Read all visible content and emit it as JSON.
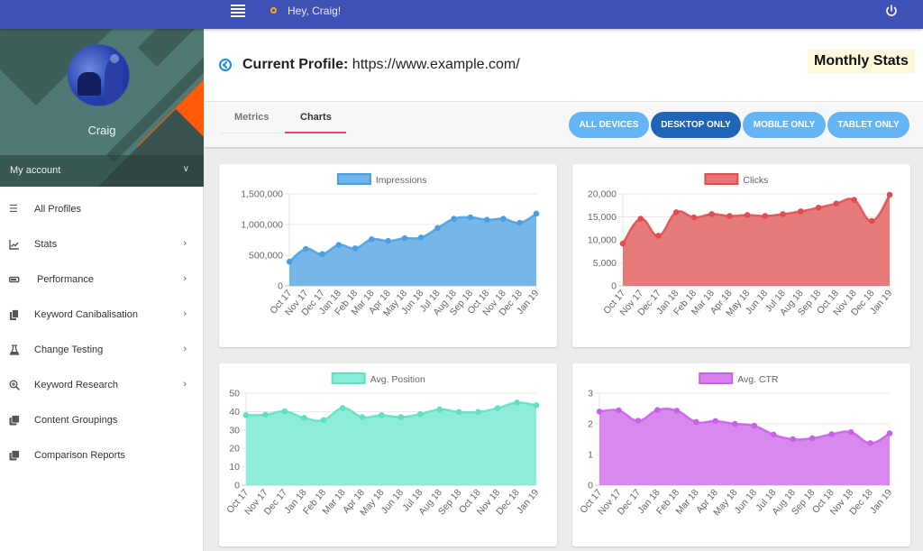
{
  "topbar": {
    "greeting": "Hey, Craig!",
    "menu_icon": "hamburger-icon",
    "status_icon": "status-dot-icon",
    "power_icon": "power-icon"
  },
  "sidebar": {
    "profile_name": "Craig",
    "account_label": "My account",
    "items": [
      {
        "label": "All Profiles",
        "icon": "list-icon",
        "glyph": "☰",
        "has_chevron": false
      },
      {
        "label": "Stats",
        "icon": "chart-line-icon",
        "glyph": "📈",
        "has_chevron": true
      },
      {
        "label": "Performance",
        "icon": "battery-icon",
        "glyph": "▭",
        "has_chevron": true
      },
      {
        "label": "Keyword Canibalisation",
        "icon": "copy-icon",
        "glyph": "❐",
        "has_chevron": true
      },
      {
        "label": "Change Testing",
        "icon": "flask-icon",
        "glyph": "⚗",
        "has_chevron": true
      },
      {
        "label": "Keyword Research",
        "icon": "zoom-in-icon",
        "glyph": "⊕",
        "has_chevron": true
      },
      {
        "label": "Content Groupings",
        "icon": "library-icon",
        "glyph": "❐",
        "has_chevron": false
      },
      {
        "label": "Comparison Reports",
        "icon": "library-icon",
        "glyph": "❐",
        "has_chevron": false
      }
    ]
  },
  "header": {
    "title_label": "Current Profile:",
    "title_value": "https://www.example.com/",
    "badge": "Monthly Stats"
  },
  "tabs": [
    {
      "label": "Metrics",
      "active": false
    },
    {
      "label": "Charts",
      "active": true
    }
  ],
  "filters": [
    {
      "label": "ALL DEVICES",
      "active": false
    },
    {
      "label": "DESKTOP ONLY",
      "active": true
    },
    {
      "label": "MOBILE ONLY",
      "active": false
    },
    {
      "label": "TABLET ONLY",
      "active": false
    }
  ],
  "chart_data": [
    {
      "type": "area",
      "title": "Impressions",
      "legend": "Impressions",
      "legend_position": "top",
      "color": "#4a9fe3",
      "fill": "#6fb3e8",
      "categories": [
        "Oct 17",
        "Nov 17",
        "Dec 17",
        "Jan 18",
        "Feb 18",
        "Mar 18",
        "Apr 18",
        "May 18",
        "Jun 18",
        "Jul 18",
        "Aug 18",
        "Sep 18",
        "Oct 18",
        "Nov 18",
        "Dec 18",
        "Jan 19"
      ],
      "values": [
        394000,
        601000,
        519000,
        667000,
        612000,
        760000,
        732000,
        777000,
        788000,
        942000,
        1094000,
        1117000,
        1078000,
        1094000,
        1029000,
        1177000
      ],
      "ylim": [
        0,
        1500000
      ],
      "yticks": [
        0,
        500000,
        1000000,
        1500000
      ],
      "ytick_labels": [
        "0",
        "500,000",
        "1,000,000",
        "1,500,000"
      ],
      "grid": true
    },
    {
      "type": "area",
      "title": "Clicks",
      "legend": "Clicks",
      "legend_position": "top",
      "color": "#e24c4c",
      "fill": "#e57373",
      "categories": [
        "Oct 17",
        "Nov 17",
        "Dec 17",
        "Jan 18",
        "Feb 18",
        "Mar 18",
        "Apr 18",
        "May 18",
        "Jun 18",
        "Jul 18",
        "Aug 18",
        "Sep 18",
        "Oct 18",
        "Nov 18",
        "Dec 18",
        "Jan 19"
      ],
      "values": [
        9200,
        14600,
        10900,
        16000,
        14900,
        15600,
        15200,
        15400,
        15200,
        15600,
        16200,
        17000,
        17900,
        18700,
        14100,
        19800
      ],
      "ylim": [
        0,
        20000
      ],
      "yticks": [
        0,
        5000,
        10000,
        15000,
        20000
      ],
      "ytick_labels": [
        "0",
        "5,000",
        "10,000",
        "15,000",
        "20,000"
      ],
      "grid": true
    },
    {
      "type": "area",
      "title": "Avg. Position",
      "legend": "Avg. Position",
      "legend_position": "top",
      "color": "#5fe0c0",
      "fill": "#88ecd6",
      "categories": [
        "Oct 17",
        "Nov 17",
        "Dec 17",
        "Jan 18",
        "Feb 18",
        "Mar 18",
        "Apr 18",
        "May 18",
        "Jun 18",
        "Jul 18",
        "Aug 18",
        "Sep 18",
        "Oct 18",
        "Nov 18",
        "Dec 18",
        "Jan 19"
      ],
      "values": [
        38.1,
        38.3,
        40.1,
        36.6,
        35.4,
        41.9,
        37.0,
        38.0,
        37.0,
        38.6,
        41.2,
        39.8,
        39.8,
        41.9,
        44.9,
        43.4
      ],
      "ylim": [
        0,
        50
      ],
      "yticks": [
        0,
        10,
        20,
        30,
        40,
        50
      ],
      "ytick_labels": [
        "0",
        "10",
        "20",
        "30",
        "40",
        "50"
      ],
      "grid": true
    },
    {
      "type": "area",
      "title": "Avg. CTR",
      "legend": "Avg. CTR",
      "legend_position": "top",
      "color": "#c860e8",
      "fill": "#d683ee",
      "categories": [
        "Oct 17",
        "Nov 17",
        "Dec 17",
        "Jan 18",
        "Feb 18",
        "Mar 18",
        "Apr 18",
        "May 18",
        "Jun 18",
        "Jul 18",
        "Aug 18",
        "Sep 18",
        "Oct 18",
        "Nov 18",
        "Dec 18",
        "Jan 19"
      ],
      "values": [
        2.4,
        2.44,
        2.1,
        2.45,
        2.43,
        2.06,
        2.09,
        2.0,
        1.94,
        1.65,
        1.5,
        1.53,
        1.66,
        1.73,
        1.37,
        1.69
      ],
      "ylim": [
        0,
        3
      ],
      "yticks": [
        0,
        1,
        2,
        3
      ],
      "ytick_labels": [
        "0",
        "1",
        "2",
        "3"
      ],
      "grid": true
    }
  ]
}
